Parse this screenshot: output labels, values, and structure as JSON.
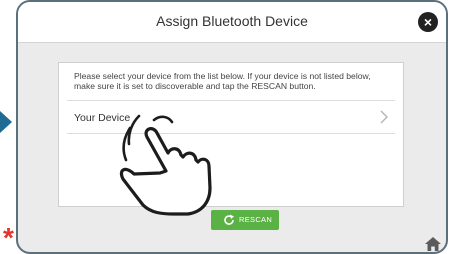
{
  "header": {
    "title": "Assign Bluetooth Device"
  },
  "dialog": {
    "instructions": "Please select your device from the list below. If your device is not listed below, make sure it is set to discoverable and tap the RESCAN button.",
    "devices": [
      {
        "label": "Your Device"
      }
    ]
  },
  "actions": {
    "rescan_label": "RESCAN"
  },
  "colors": {
    "accent_green": "#5bb244",
    "asterisk_red": "#e0362b",
    "arrow_blue": "#1f6b94"
  },
  "icons": [
    "close-icon",
    "chevron-right-icon",
    "refresh-icon",
    "home-icon",
    "asterisk-icon",
    "pointing-hand-icon",
    "arrow-icon"
  ]
}
